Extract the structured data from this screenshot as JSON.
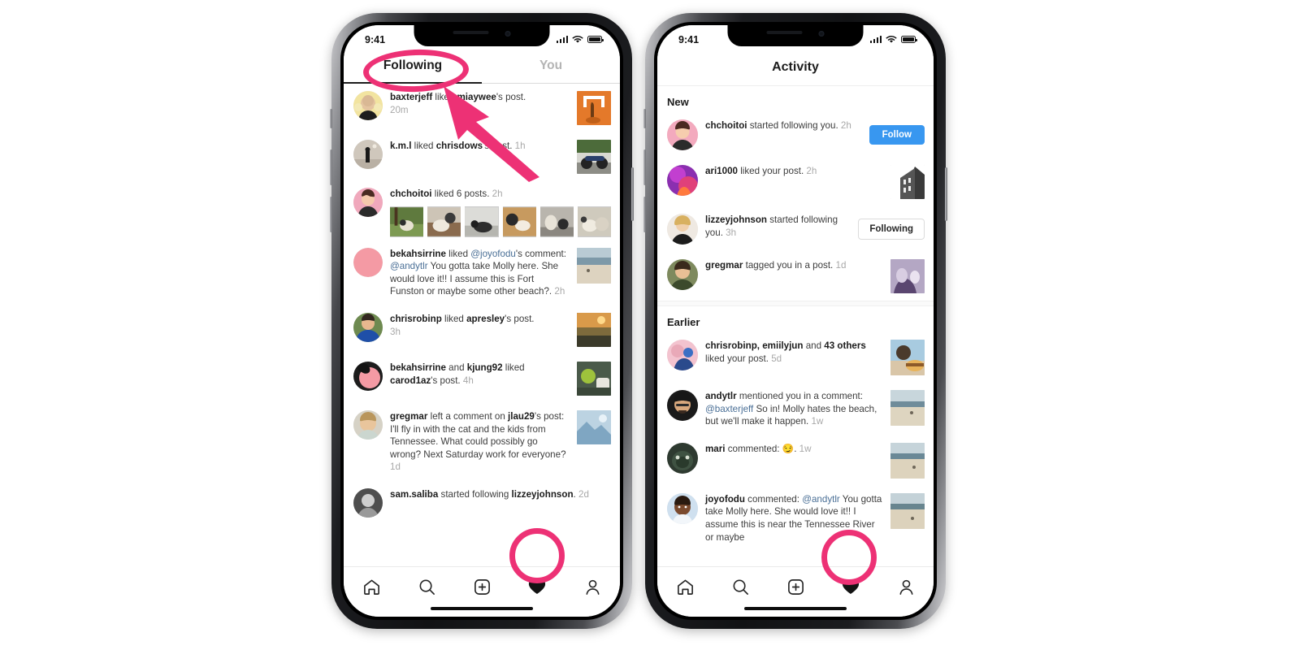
{
  "meta": {
    "accent_pink": "#ed3175",
    "instagram_blue": "#3897f0",
    "background": "#ffffff"
  },
  "phone_left": {
    "status": {
      "time": "9:41",
      "signal_icon": "cellular-bars-icon",
      "wifi_icon": "wifi-icon",
      "battery_icon": "battery-icon"
    },
    "tabs": [
      {
        "label": "Following",
        "active": true
      },
      {
        "label": "You",
        "active": false
      }
    ],
    "items": [
      {
        "avatar": "baxterjeff-avatar",
        "user": "baxterjeff",
        "action": " liked ",
        "target": "miaywee",
        "suffix": "'s post.",
        "time": "20m",
        "thumb": "orange-art-thumb"
      },
      {
        "avatar": "kml-avatar",
        "user": "k.m.l",
        "action": " liked ",
        "target": "chrisdows",
        "suffix": "'s post.",
        "time": "1h",
        "thumb": "motorcycle-thumb"
      },
      {
        "avatar": "chchoitoi-avatar",
        "user": "chchoitoi",
        "action": " liked 6 posts.",
        "target": "",
        "suffix": "",
        "time": "2h",
        "thumbs": [
          "dog-grass-thumb",
          "dog-couch-thumb",
          "dog-floor-thumb",
          "dog-wood-thumb",
          "dog-street-thumb",
          "dogs-pair-thumb"
        ]
      },
      {
        "avatar": "bekahsirrine-avatar",
        "user": "bekahsirrine",
        "action": " liked ",
        "mention1": "@joyofodu",
        "suffix": "'s comment: ",
        "mention2": "@andytlr",
        "body": " You gotta take Molly here. She would love it!! I assume this is Fort Funston or maybe some other beach?.",
        "time": "2h",
        "thumb": "beach-thumb"
      },
      {
        "avatar": "chrisrobinp-avatar",
        "user": "chrisrobinp",
        "action": " liked ",
        "target": "apresley",
        "suffix": "'s post.",
        "time": "3h",
        "thumb": "sunset-thumb"
      },
      {
        "avatar": "bekahsirrine2-avatar",
        "user": "bekahsirrine",
        "action": " and ",
        "target": "kjung92",
        "action2": " liked ",
        "target2": "carod1az",
        "suffix": "'s post.",
        "time": "4h",
        "thumb": "drink-thumb"
      },
      {
        "avatar": "gregmar-avatar",
        "user": "gregmar",
        "action": " left a comment on ",
        "target": "jlau29",
        "suffix": "'s post:  I'll fly in with the cat and the kids from Tennessee. What could possibly go wrong? Next Saturday work for everyone?",
        "time": "1d",
        "thumb": "blue-thumb"
      },
      {
        "avatar": "samsaliba-avatar",
        "user": "sam.saliba",
        "action": " started following ",
        "target": "lizzeyjohnson",
        "suffix": ".",
        "time": "2d",
        "thumb": ""
      }
    ],
    "bottom_nav": [
      {
        "icon": "home-icon",
        "active": false
      },
      {
        "icon": "search-icon",
        "active": false
      },
      {
        "icon": "new-post-icon",
        "active": false
      },
      {
        "icon": "heart-icon",
        "active": true
      },
      {
        "icon": "profile-icon",
        "active": false
      }
    ]
  },
  "phone_right": {
    "status": {
      "time": "9:41",
      "signal_icon": "cellular-bars-icon",
      "wifi_icon": "wifi-icon",
      "battery_icon": "battery-icon"
    },
    "header_title": "Activity",
    "sections": [
      {
        "title": "New",
        "items": [
          {
            "avatar": "chchoitoi-avatar",
            "user": "chchoitoi",
            "action": " started following you.",
            "time": "2h",
            "button": "Follow",
            "button_style": "primary"
          },
          {
            "avatar": "ari1000-avatar",
            "user": "ari1000",
            "action": " liked your post.",
            "time": "2h",
            "thumb": "building-thumb"
          },
          {
            "avatar": "lizzeyjohnson-avatar",
            "user": "lizzeyjohnson",
            "action": " started following you.",
            "time": "3h",
            "button": "Following",
            "button_style": "ghost"
          },
          {
            "avatar": "gregmar-avatar",
            "user": "gregmar",
            "action": " tagged you in a post.",
            "time": "1d",
            "thumb": "dogs-purple-thumb"
          }
        ]
      },
      {
        "title": "Earlier",
        "items": [
          {
            "avatar": "chrisrobinp-avatar",
            "user": "chrisrobinp, emiilyjun",
            "action": " and ",
            "bold2": "43 others",
            "action2": " liked your post.",
            "time": "5d",
            "thumb": "burger-thumb"
          },
          {
            "avatar": "andytlr-avatar",
            "user": "andytlr",
            "action": " mentioned you in a comment: ",
            "mention": "@baxterjeff",
            "body": " So in! Molly hates the beach, but we'll make it happen.",
            "time": "1w",
            "thumb": "beach2-thumb"
          },
          {
            "avatar": "mari-avatar",
            "user": "mari",
            "action": " commented: ",
            "emoji": "😏",
            "body": ".",
            "time": "1w",
            "thumb": "beach3-thumb"
          },
          {
            "avatar": "joyofodu-avatar",
            "user": "joyofodu",
            "action": " commented: ",
            "mention": "@andytlr",
            "body": " You gotta take Molly here. She would love it!! I assume this is near the Tennessee River or maybe",
            "time": "",
            "thumb": "beach4-thumb"
          }
        ]
      }
    ],
    "bottom_nav": [
      {
        "icon": "home-icon",
        "active": false
      },
      {
        "icon": "search-icon",
        "active": false
      },
      {
        "icon": "new-post-icon",
        "active": false
      },
      {
        "icon": "heart-icon",
        "active": true
      },
      {
        "icon": "profile-icon",
        "active": false
      }
    ]
  },
  "annotations": {
    "ellipse_following_tab": "highlight-ellipse-following-tab",
    "arrow_to_following": "pink-arrow-pointing-to-following-tab",
    "ring_left_heart": "highlight-ring-activity-tab-left",
    "ring_right_heart": "highlight-ring-activity-tab-right"
  }
}
